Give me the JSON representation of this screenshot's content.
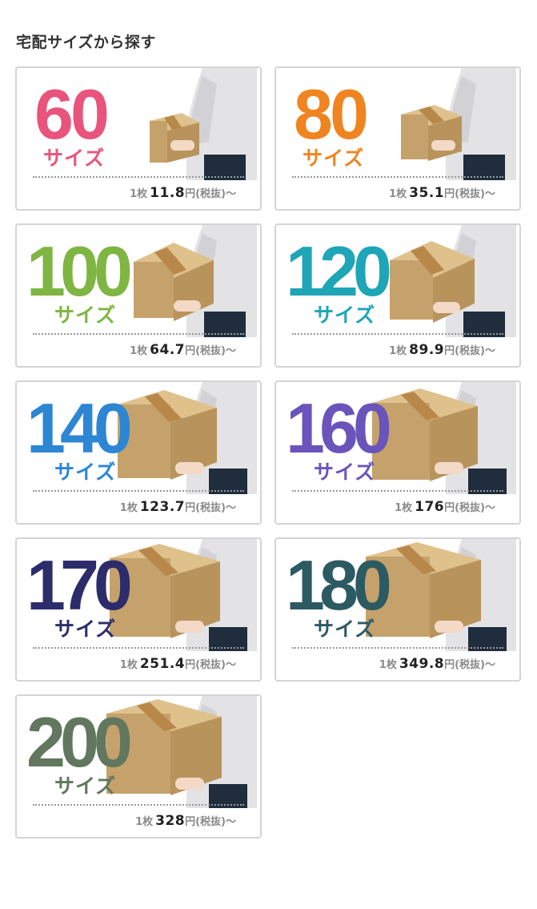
{
  "heading": "宅配サイズから探す",
  "cards": [
    {
      "size": "60",
      "label": "サイズ",
      "unit": "1枚",
      "price": "11.8",
      "suffix": "円(税抜)〜",
      "color": "#e8547c",
      "box": "small"
    },
    {
      "size": "80",
      "label": "サイズ",
      "unit": "1枚",
      "price": "35.1",
      "suffix": "円(税抜)〜",
      "color": "#f08421",
      "box": "small"
    },
    {
      "size": "100",
      "label": "サイズ",
      "unit": "1枚",
      "price": "64.7",
      "suffix": "円(税抜)〜",
      "color": "#7fb542",
      "box": "medium"
    },
    {
      "size": "120",
      "label": "サイズ",
      "unit": "1枚",
      "price": "89.9",
      "suffix": "円(税抜)〜",
      "color": "#1ea5b6",
      "box": "medium"
    },
    {
      "size": "140",
      "label": "サイズ",
      "unit": "1枚",
      "price": "123.7",
      "suffix": "円(税抜)〜",
      "color": "#2c86d4",
      "box": "large"
    },
    {
      "size": "160",
      "label": "サイズ",
      "unit": "1枚",
      "price": "176",
      "suffix": "円(税抜)〜",
      "color": "#6a54bc",
      "box": "large"
    },
    {
      "size": "170",
      "label": "サイズ",
      "unit": "1枚",
      "price": "251.4",
      "suffix": "円(税抜)〜",
      "color": "#2d2c6b",
      "box": "large"
    },
    {
      "size": "180",
      "label": "サイズ",
      "unit": "1枚",
      "price": "349.8",
      "suffix": "円(税抜)〜",
      "color": "#2c5a63",
      "box": "large"
    },
    {
      "size": "200",
      "label": "サイズ",
      "unit": "1枚",
      "price": "328",
      "suffix": "円(税抜)〜",
      "color": "#61775e",
      "box": "large"
    }
  ]
}
